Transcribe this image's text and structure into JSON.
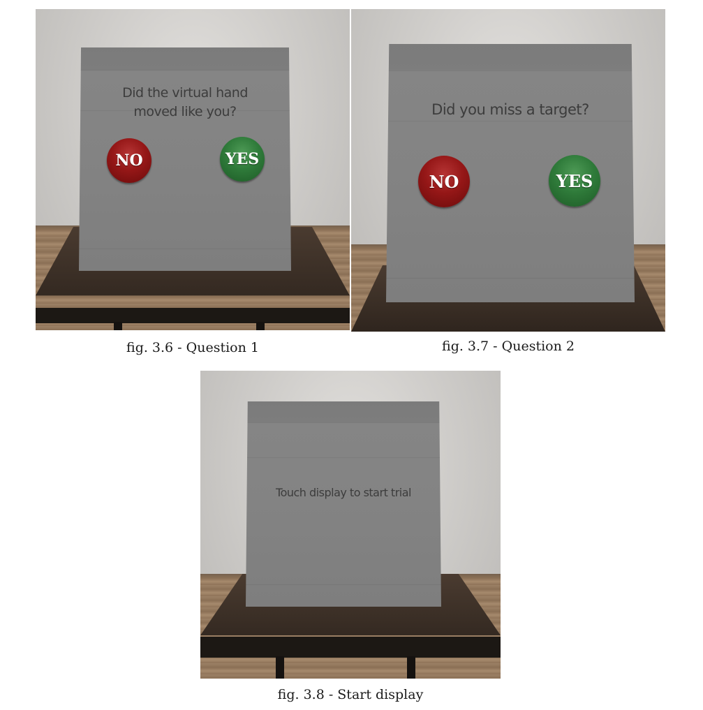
{
  "figures": [
    {
      "question": "Did the virtual hand\nmoved like you?",
      "no_label": "NO",
      "yes_label": "YES",
      "caption": "fig. 3.6 - Question 1"
    },
    {
      "question": "Did you miss a target?",
      "no_label": "NO",
      "yes_label": "YES",
      "caption": "fig. 3.7 - Question 2"
    },
    {
      "question": "Touch display to start trial",
      "caption": "fig. 3.8 - Start display"
    }
  ],
  "colors": {
    "no_button": "#951717",
    "yes_button": "#2f7b3a",
    "panel": "#838383",
    "panel_text": "#3c3c3c"
  }
}
